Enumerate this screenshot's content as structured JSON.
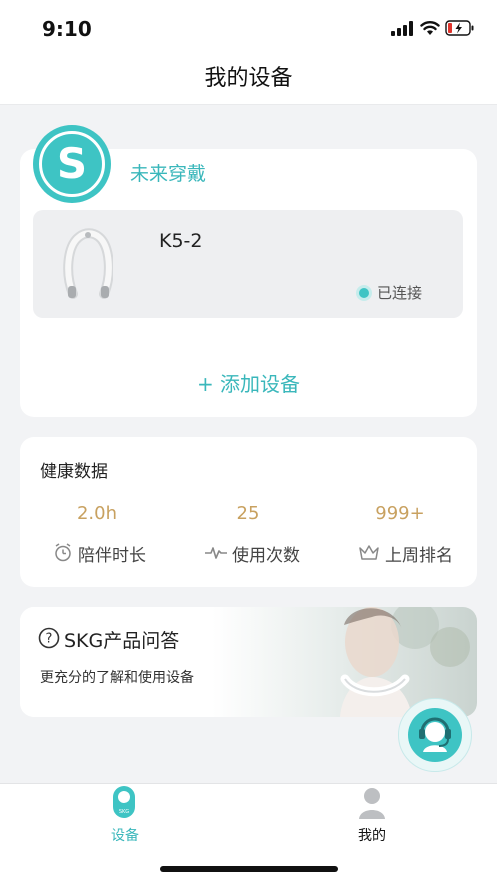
{
  "status_bar": {
    "time": "9:10"
  },
  "header": {
    "title": "我的设备"
  },
  "brand": {
    "logo_letter": "S",
    "name": "未来穿戴"
  },
  "device": {
    "name": "K5-2",
    "status": "已连接"
  },
  "add_device_label": "+ 添加设备",
  "health": {
    "title": "健康数据",
    "stats": [
      {
        "value": "2.0h",
        "label": "陪伴时长",
        "icon": "stopwatch-icon"
      },
      {
        "value": "25",
        "label": "使用次数",
        "icon": "pulse-icon"
      },
      {
        "value": "999+",
        "label": "上周排名",
        "icon": "crown-icon"
      }
    ]
  },
  "faq": {
    "title": "SKG产品问答",
    "subtitle": "更充分的了解和使用设备"
  },
  "tabs": [
    {
      "label": "设备",
      "icon_text": "SKG",
      "active": true
    },
    {
      "label": "我的",
      "active": false
    }
  ],
  "colors": {
    "accent": "#3ab7bb",
    "gold": "#c8a160",
    "page_bg": "#f2f3f5"
  }
}
